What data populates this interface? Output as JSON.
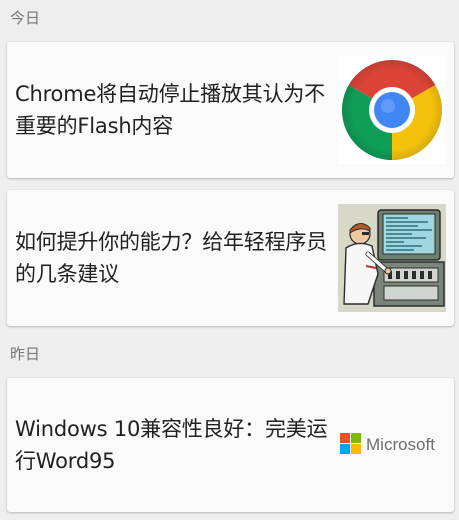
{
  "sections": [
    {
      "header": "今日",
      "items": [
        {
          "title": "Chrome将自动停止播放其认为不重要的Flash内容",
          "thumbnail": "chrome-logo"
        },
        {
          "title": "如何提升你的能力？给年轻程序员的几条建议",
          "thumbnail": "programmer-illustration"
        }
      ]
    },
    {
      "header": "昨日",
      "items": [
        {
          "title": "Windows 10兼容性良好：完美运行Word95",
          "thumbnail": "microsoft-logo"
        }
      ]
    }
  ],
  "logos": {
    "microsoft_text": "Microsoft"
  },
  "colors": {
    "background": "#eeeeee",
    "card": "#fafafa",
    "title_text": "#212121",
    "header_text": "#757575",
    "chrome_red": "#db4437",
    "chrome_yellow": "#f4c20d",
    "chrome_green": "#0f9d58",
    "chrome_blue": "#4285f4",
    "ms_red": "#f25022",
    "ms_green": "#7fba00",
    "ms_blue": "#00a4ef",
    "ms_yellow": "#ffb900"
  }
}
